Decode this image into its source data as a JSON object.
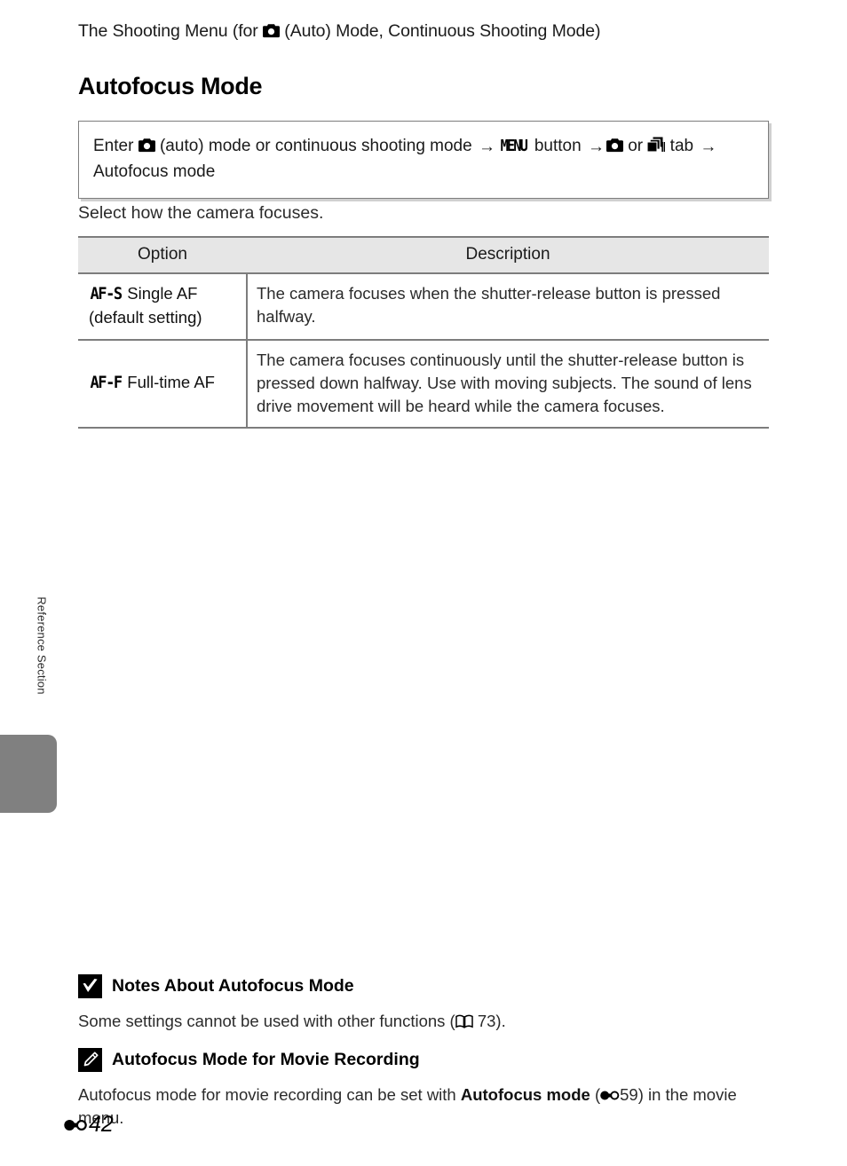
{
  "page": {
    "running_header_before": "The Shooting Menu (for ",
    "running_header_icon": "camera-auto-mode-icon",
    "running_header_after": " (Auto) Mode, Continuous Shooting Mode)",
    "section_title": "Autofocus Mode",
    "intro_line": "Select how the camera focuses.",
    "side_tab_label": "Reference Section",
    "footer_symbol": "E",
    "footer_page_number": "42"
  },
  "nav_box": {
    "seg1": "Enter ",
    "icon1": "camera-auto-mode-icon",
    "seg2": " (auto) mode or continuous shooting mode ",
    "arrow1": "→",
    "menu_label": "MENU",
    "seg3": " button ",
    "arrow2": "→",
    "icon2": "camera-auto-mode-icon",
    "seg4": " or ",
    "icon3": "continuous-shooting-icon",
    "seg5": " tab ",
    "arrow3": "→",
    "seg6": "Autofocus mode"
  },
  "table": {
    "headers": [
      "Option",
      "Description"
    ],
    "rows": [
      {
        "glyph": "AF-S",
        "option_line1": " Single AF",
        "option_line2": "(default setting)",
        "description": "The camera focuses when the shutter-release button is pressed halfway."
      },
      {
        "glyph": "AF-F",
        "option_line1": " Full-time AF",
        "option_line2": "",
        "description": "The camera focuses continuously until the shutter-release button is pressed down halfway. Use with moving subjects. The sound of lens drive movement will be heard while the camera focuses."
      }
    ]
  },
  "notes": [
    {
      "icon": "caution-check-icon",
      "title": "Notes About Autofocus Mode",
      "body_before": "Some settings cannot be used with other functions (",
      "body_icon": "book-reference-icon",
      "body_after": " 73)."
    },
    {
      "icon": "pencil-note-icon",
      "title": "Autofocus Mode for Movie Recording",
      "body_before": "Autofocus mode for movie recording can be set with ",
      "body_bold": "Autofocus mode",
      "body_mid": " (",
      "body_icon": "e-reference-icon",
      "body_after": "59) in the movie menu."
    }
  ],
  "colors": {
    "table_header_bg": "#e6e6e6",
    "table_border": "#7d7d7d",
    "side_tab": "#808080",
    "text": "#2b2b2b"
  }
}
